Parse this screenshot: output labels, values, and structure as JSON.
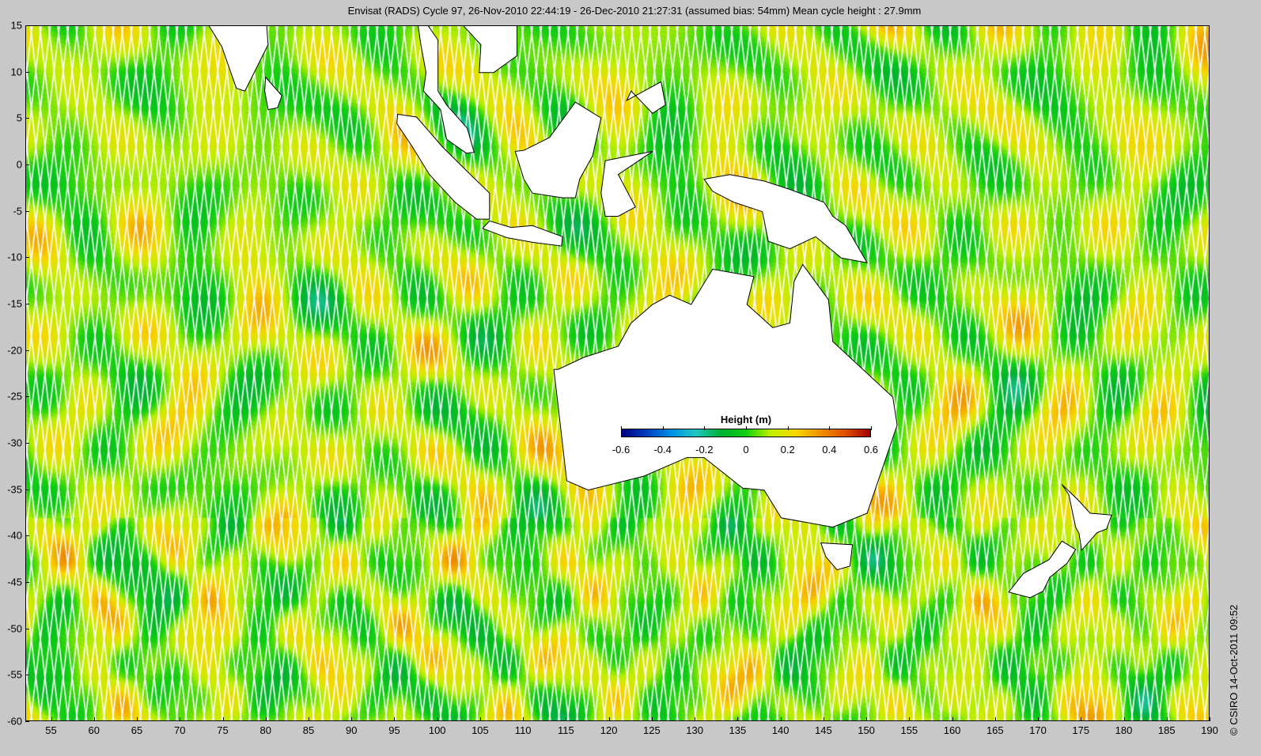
{
  "title": "Envisat (RADS) Cycle 97, 26-Nov-2010 22:44:19 - 26-Dec-2010 21:27:31 (assumed bias: 54mm)  Mean cycle height : 27.9mm",
  "credit": "© CSIRO 14-Oct-2011 09:52",
  "map": {
    "lon_range": [
      52,
      190
    ],
    "lat_range": [
      -60,
      15
    ],
    "x_ticks": [
      "55",
      "60",
      "65",
      "70",
      "75",
      "80",
      "85",
      "90",
      "95",
      "100",
      "105",
      "110",
      "115",
      "120",
      "125",
      "130",
      "135",
      "140",
      "145",
      "150",
      "155",
      "160",
      "165",
      "170",
      "175",
      "180",
      "185",
      "190"
    ],
    "y_ticks": [
      "15",
      "10",
      "5",
      "0",
      "-5",
      "-10",
      "-15",
      "-20",
      "-25",
      "-30",
      "-35",
      "-40",
      "-45",
      "-50",
      "-55",
      "-60"
    ],
    "land_color": "#ffffff",
    "track_gap_color": "#ffffff"
  },
  "colorbar": {
    "title": "Height (m)",
    "range": [
      -0.6,
      0.6
    ],
    "ticks": [
      "-0.6",
      "-0.4",
      "-0.2",
      "0",
      "0.2",
      "0.4",
      "0.6"
    ],
    "colormap": [
      "#00007f",
      "#0040c0",
      "#0090e8",
      "#20c8c0",
      "#00b030",
      "#10d010",
      "#c0f000",
      "#f8d800",
      "#f09000",
      "#e05000",
      "#a00000"
    ]
  }
}
